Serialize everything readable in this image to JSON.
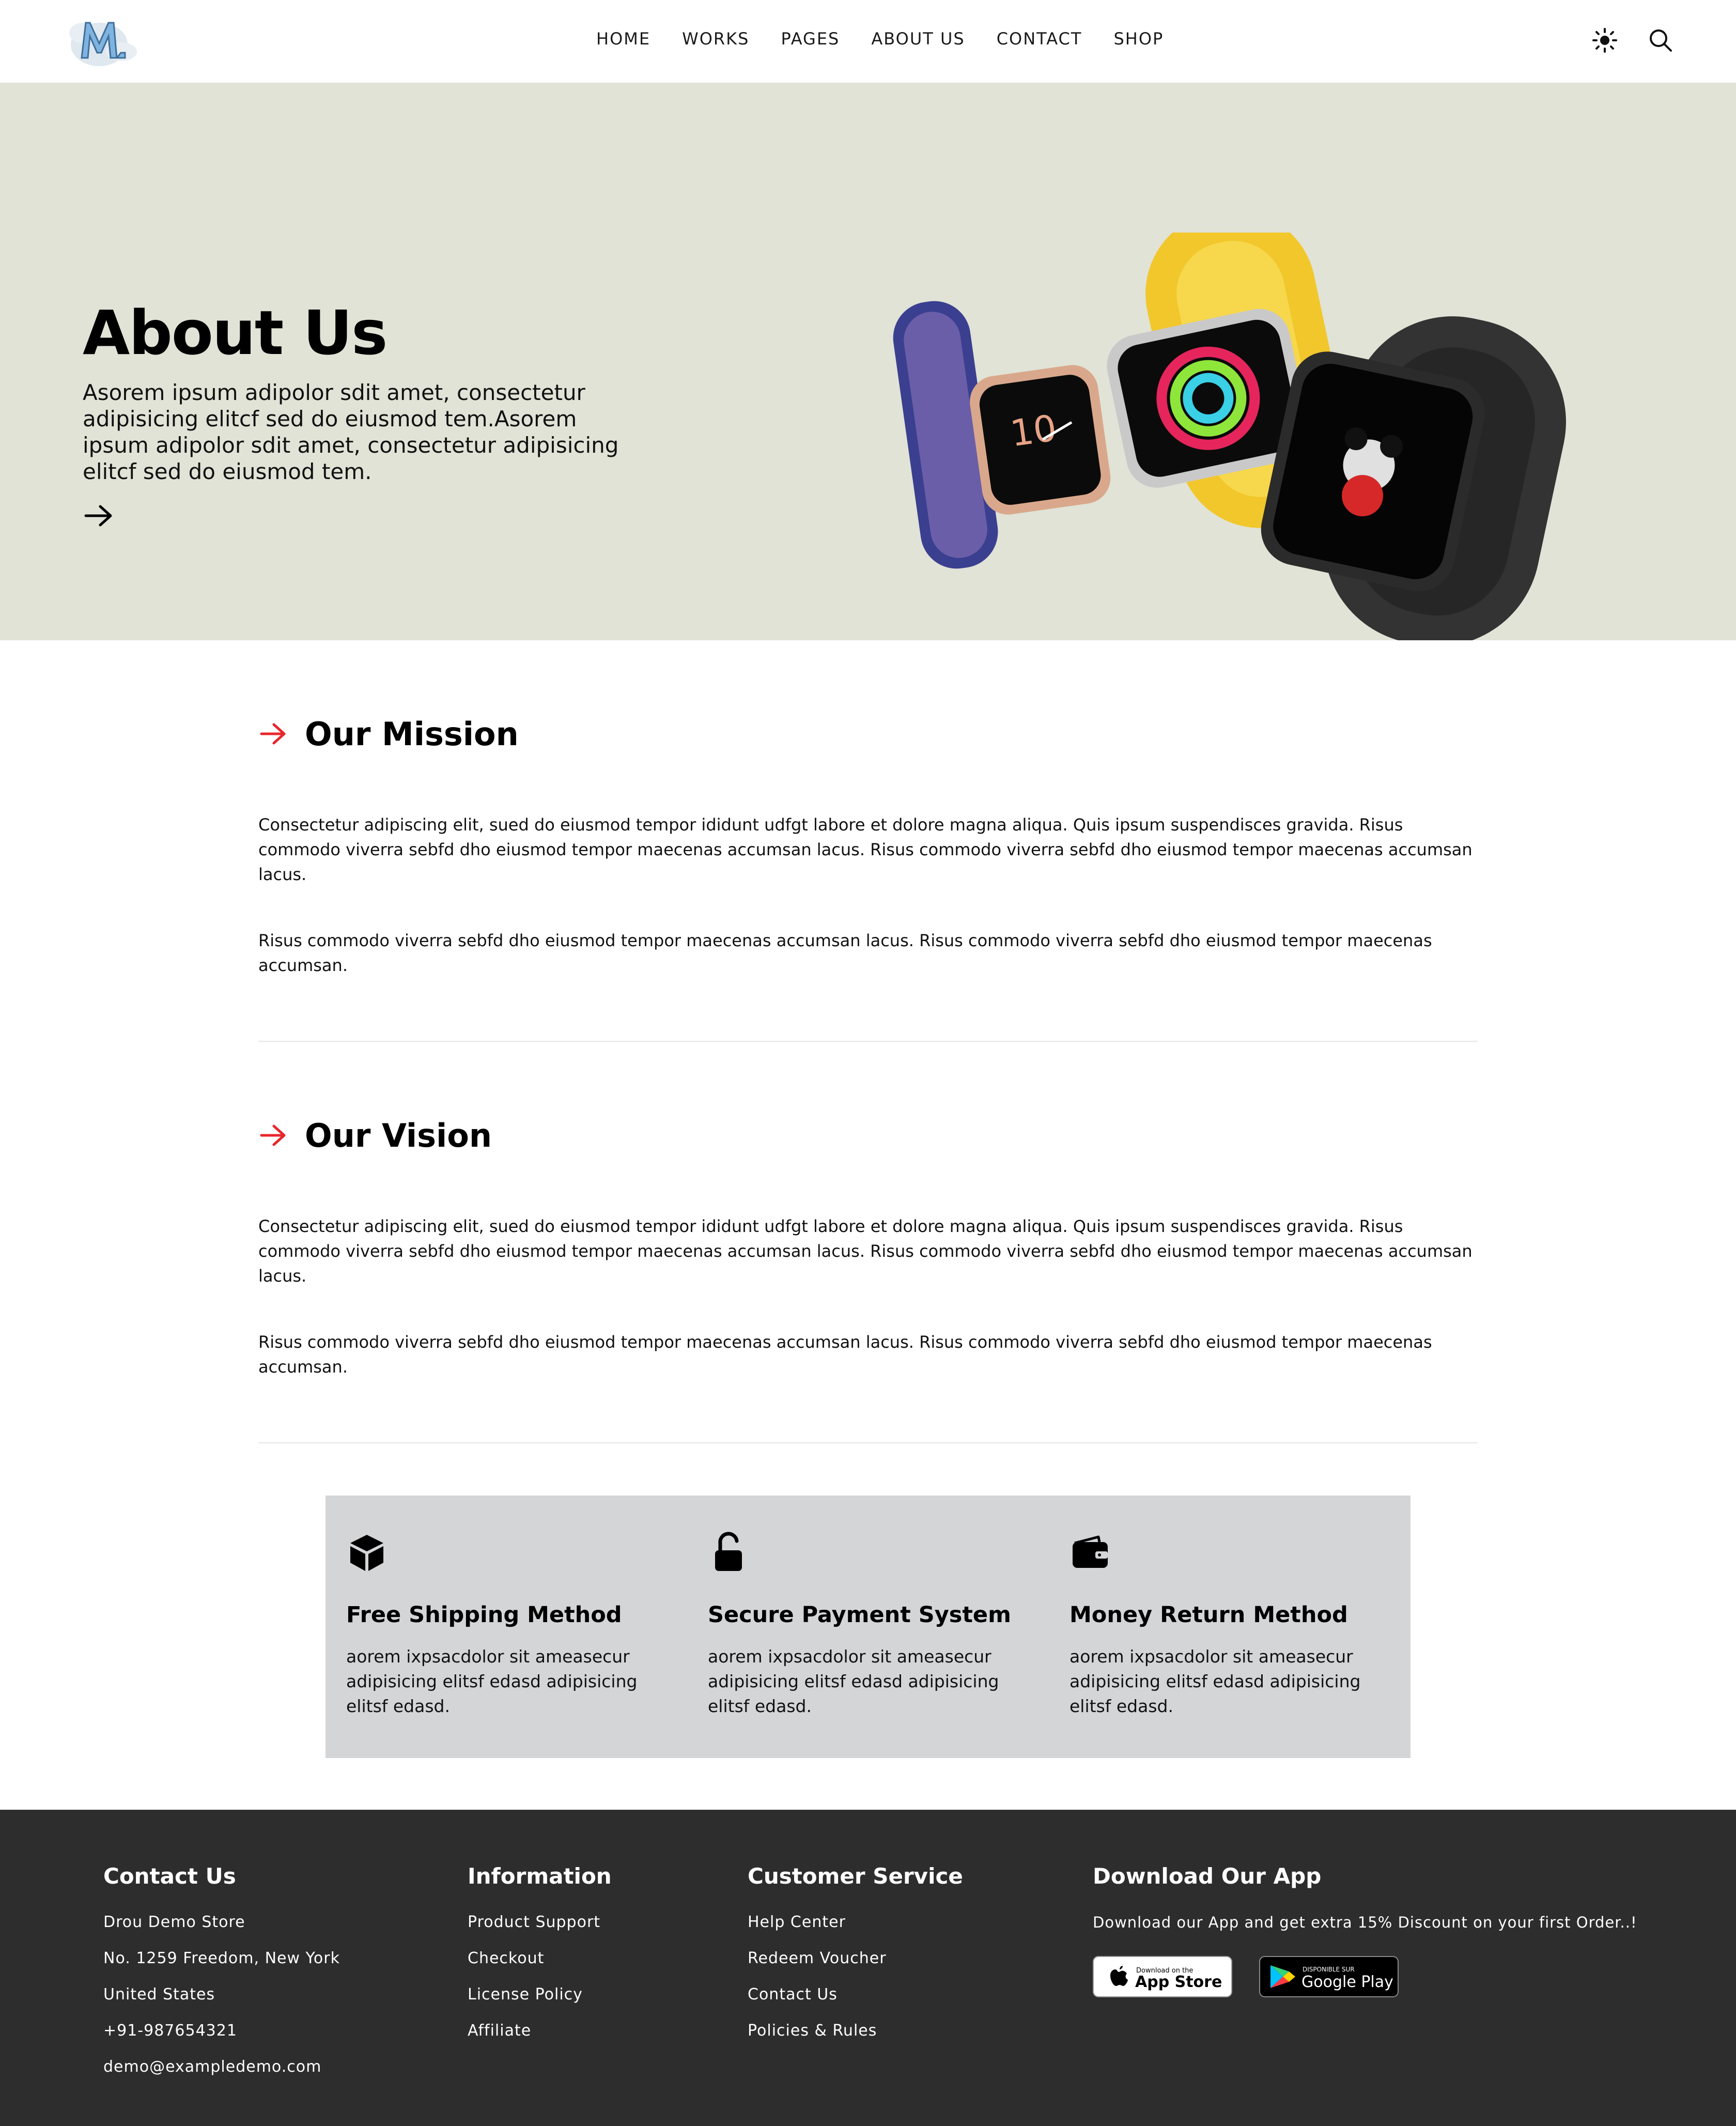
{
  "brand": {
    "logo_alt": "M logo",
    "logo_color": "#7fb3e0"
  },
  "nav": {
    "items": [
      "HOME",
      "WORKS",
      "PAGES",
      "ABOUT US",
      "CONTACT",
      "SHOP"
    ]
  },
  "header_icons": {
    "theme": "sun-icon",
    "search": "search-icon"
  },
  "hero": {
    "title": "About Us",
    "text": "Asorem ipsum adipolor sdit amet, consectetur adipisicing elitcf sed do eiusmod tem.Asorem ipsum adipolor sdit amet, consectetur adipisicing elitcf sed do eiusmod tem.",
    "background": "#e0e3d6"
  },
  "mission": {
    "title": "Our Mission",
    "p1": "Consectetur adipiscing elit, sued do eiusmod tempor ididunt udfgt labore et dolore magna aliqua. Quis ipsum suspendisces gravida. Risus commodo viverra sebfd dho eiusmod tempor maecenas accumsan lacus. Risus commodo viverra sebfd dho eiusmod tempor maecenas accumsan lacus.",
    "p2": "Risus commodo viverra sebfd dho eiusmod tempor maecenas accumsan lacus. Risus commodo viverra sebfd dho eiusmod tempor maecenas accumsan."
  },
  "vision": {
    "title": "Our Vision",
    "p1": "Consectetur adipiscing elit, sued do eiusmod tempor ididunt udfgt labore et dolore magna aliqua. Quis ipsum suspendisces gravida. Risus commodo viverra sebfd dho eiusmod tempor maecenas accumsan lacus. Risus commodo viverra sebfd dho eiusmod tempor maecenas accumsan lacus.",
    "p2": "Risus commodo viverra sebfd dho eiusmod tempor maecenas accumsan lacus. Risus commodo viverra sebfd dho eiusmod tempor maecenas accumsan."
  },
  "accent_color": "#e8262b",
  "features": [
    {
      "icon": "box-icon",
      "title": "Free Shipping Method",
      "text": "aorem ixpsacdolor sit ameasecur adipisicing elitsf edasd adipisicing elitsf edasd."
    },
    {
      "icon": "unlock-icon",
      "title": "Secure Payment System",
      "text": "aorem ixpsacdolor sit ameasecur adipisicing elitsf edasd adipisicing elitsf edasd."
    },
    {
      "icon": "wallet-icon",
      "title": "Money Return Method",
      "text": "aorem ixpsacdolor sit ameasecur adipisicing elitsf edasd adipisicing elitsf edasd."
    }
  ],
  "footer": {
    "contact": {
      "title": "Contact Us",
      "items": [
        "Drou Demo Store",
        "No. 1259 Freedom, New York",
        "United States",
        "+91-987654321",
        "demo@exampledemo.com"
      ]
    },
    "information": {
      "title": "Information",
      "items": [
        "Product Support",
        "Checkout",
        "License Policy",
        "Affiliate"
      ]
    },
    "service": {
      "title": "Customer Service",
      "items": [
        "Help Center",
        "Redeem Voucher",
        "Contact Us",
        "Policies & Rules"
      ]
    },
    "app": {
      "title": "Download Our App",
      "text": "Download our App and get extra 15% Discount on your first Order..!",
      "app_store": {
        "small": "Download on the",
        "big": "App Store"
      },
      "google_play": {
        "small": "DISPONIBLE SUR",
        "big": "Google Play"
      }
    }
  }
}
